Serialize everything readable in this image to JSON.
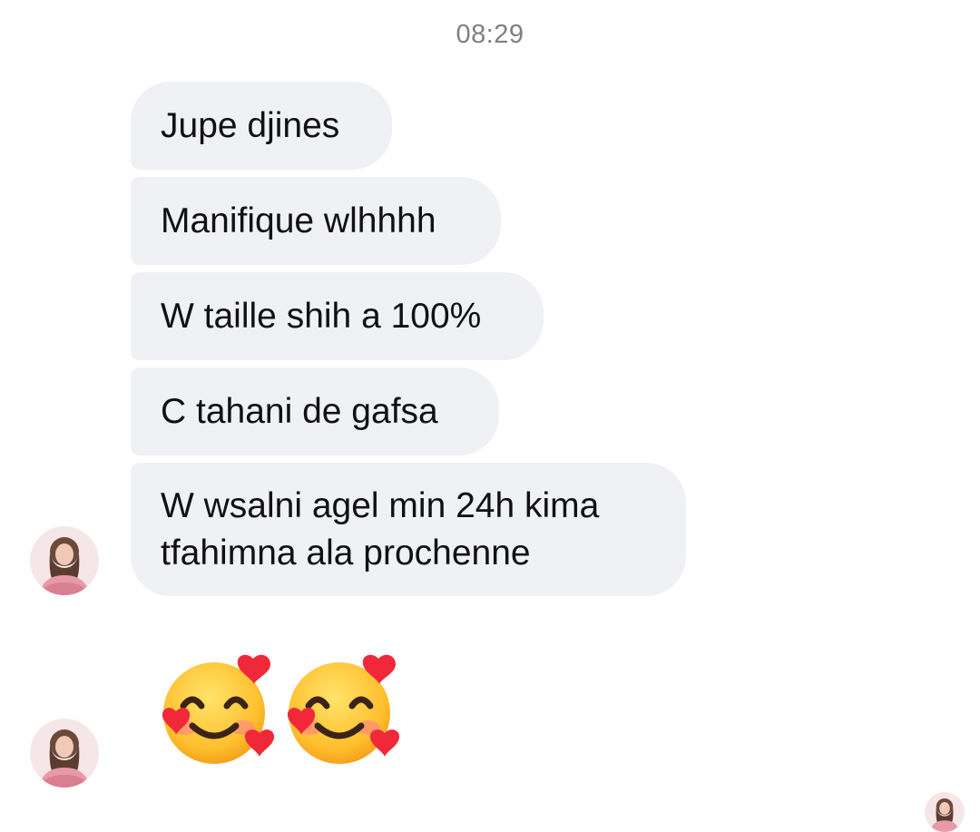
{
  "chat": {
    "timestamp": "08:29",
    "messages": [
      {
        "text": "Jupe djines"
      },
      {
        "text": "Manifique wlhhhh"
      },
      {
        "text": "W taille shih a 100%"
      },
      {
        "text": "C tahani de gafsa"
      },
      {
        "text": "W wsalni agel min 24h kima tfahimna ala prochenne"
      }
    ],
    "emoji_message": {
      "emoji": [
        "smiling-face-with-hearts",
        "smiling-face-with-hearts"
      ]
    }
  },
  "sender": {
    "avatar": "user-avatar"
  },
  "read_receipt": {
    "avatar": "seen-avatar"
  },
  "colors": {
    "incoming_bubble": "#f0f1f4",
    "timestamp": "#7d7f84",
    "text": "#111111"
  }
}
